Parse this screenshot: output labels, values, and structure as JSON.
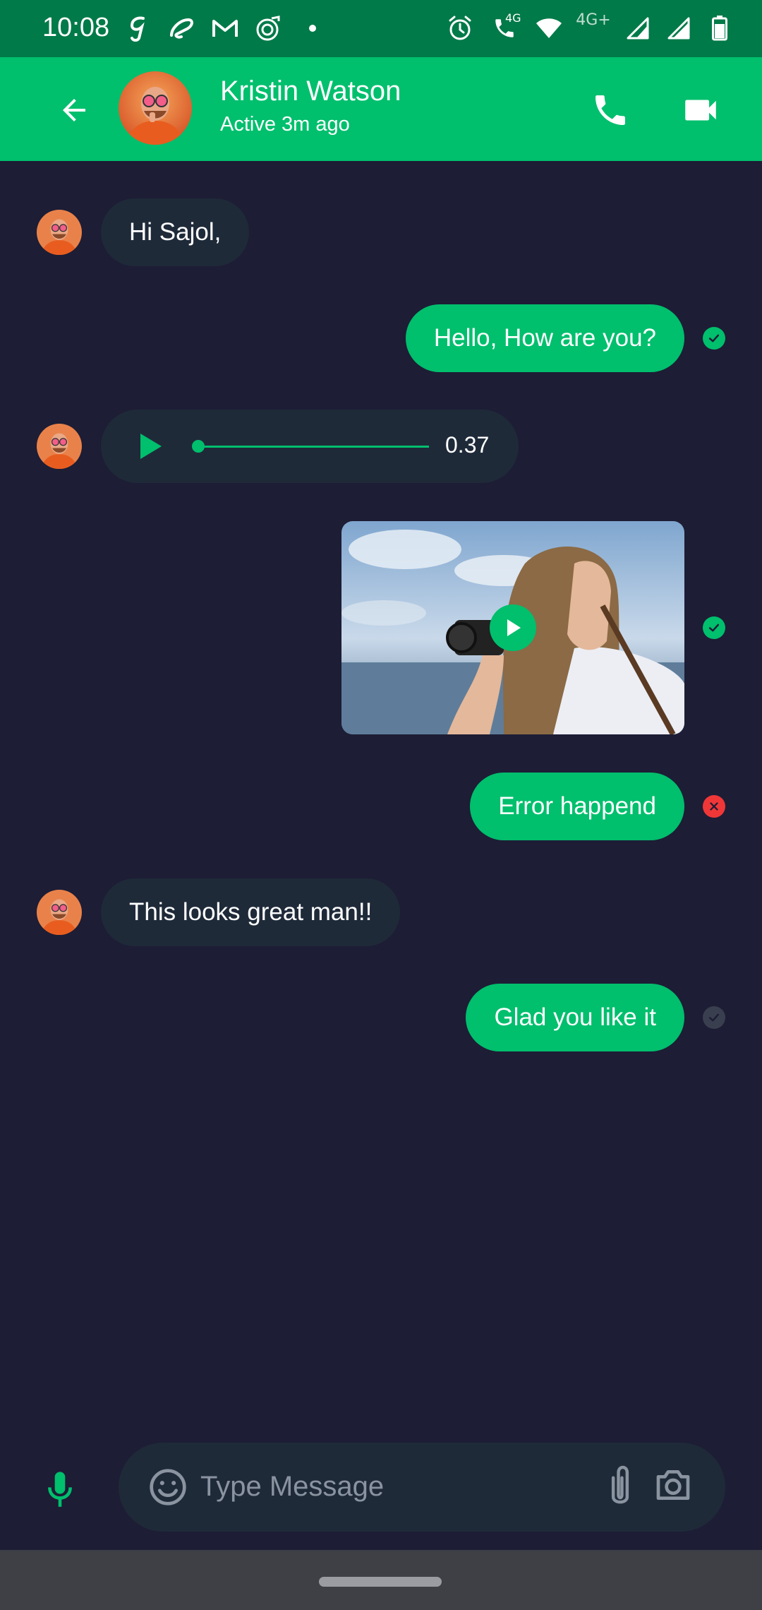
{
  "status_bar": {
    "time": "10:08",
    "left_icons": [
      "g-app-icon",
      "airtel-icon",
      "gmail-icon",
      "music-icon",
      "dot-icon"
    ],
    "right_icons": [
      "alarm-icon",
      "volte-call-icon",
      "wifi-icon",
      "signal-icon",
      "signal-icon",
      "battery-icon"
    ],
    "network_label": "4G+",
    "call_label": "4G"
  },
  "header": {
    "title": "Kristin Watson",
    "subtitle": "Active 3m ago",
    "back_icon": "arrow-back-icon",
    "call_icon": "phone-icon",
    "video_icon": "videocam-icon",
    "accent": "#00BF6D"
  },
  "messages": [
    {
      "type": "text",
      "from": "them",
      "text": "Hi Sajol,"
    },
    {
      "type": "text",
      "from": "me",
      "text": "Hello, How are you?",
      "status": "viewed"
    },
    {
      "type": "audio",
      "from": "them",
      "duration": "0.37"
    },
    {
      "type": "video",
      "from": "me",
      "status": "viewed"
    },
    {
      "type": "text",
      "from": "me",
      "text": "Error happend",
      "status": "error"
    },
    {
      "type": "text",
      "from": "them",
      "text": "This looks great man!!"
    },
    {
      "type": "text",
      "from": "me",
      "text": "Glad you like it",
      "status": "sent"
    }
  ],
  "input": {
    "placeholder": "Type Message",
    "mic_icon": "mic-icon",
    "emoji_icon": "emoji-icon",
    "attach_icon": "attach-icon",
    "camera_icon": "camera-icon"
  },
  "colors": {
    "background": "#1D1D35",
    "incoming_bubble": "#1F2A39",
    "outgoing_bubble": "#00BF6D",
    "error": "#F03738",
    "status_bar": "#007A48"
  }
}
